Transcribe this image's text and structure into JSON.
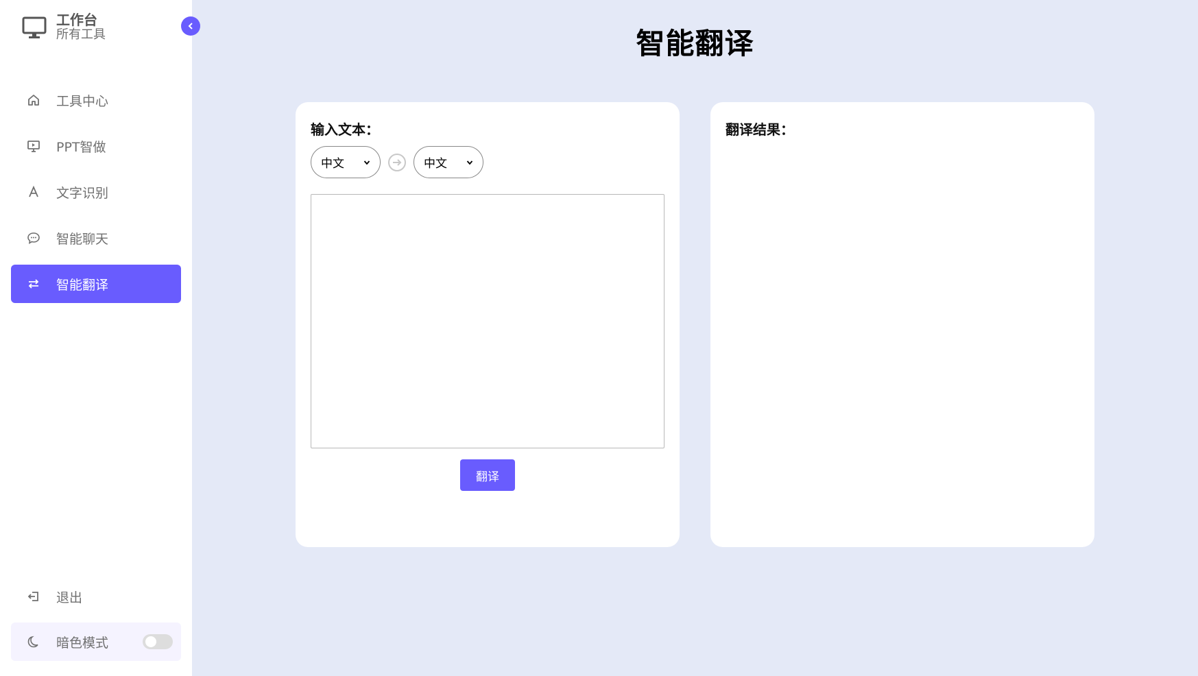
{
  "brand": {
    "title": "工作台",
    "subtitle": "所有工具"
  },
  "sidebar": {
    "items": [
      {
        "label": "工具中心",
        "icon": "home-icon"
      },
      {
        "label": "PPT智做",
        "icon": "presentation-icon"
      },
      {
        "label": "文字识别",
        "icon": "text-a-icon"
      },
      {
        "label": "智能聊天",
        "icon": "chat-bubble-icon"
      },
      {
        "label": "智能翻译",
        "icon": "swap-arrows-icon",
        "active": true
      }
    ],
    "logout_label": "退出",
    "dark_mode_label": "暗色模式",
    "dark_mode_on": false
  },
  "main": {
    "title": "智能翻译",
    "input_label": "输入文本：",
    "source_lang": "中文",
    "target_lang": "中文",
    "translate_label": "翻译",
    "result_label": "翻译结果："
  },
  "colors": {
    "accent": "#695cfe",
    "background": "#e4e9f7",
    "card": "#ffffff"
  }
}
